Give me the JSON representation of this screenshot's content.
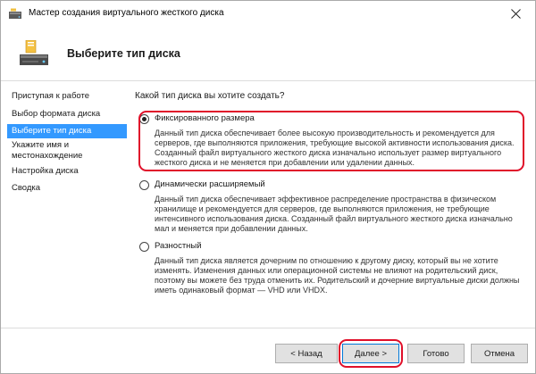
{
  "window": {
    "title": "Мастер создания виртуального жесткого диска"
  },
  "header": {
    "title": "Выберите тип диска"
  },
  "sidebar": {
    "items": [
      {
        "label": "Приступая к работе"
      },
      {
        "label": "Выбор формата диска"
      },
      {
        "label": "Выберите тип диска"
      },
      {
        "label": "Укажите имя и\nместонахождение"
      },
      {
        "label": "Настройка диска"
      },
      {
        "label": "Сводка"
      }
    ],
    "active_index": 2
  },
  "main": {
    "question": "Какой тип диска вы хотите создать?",
    "options": [
      {
        "label": "Фиксированного размера",
        "selected": true,
        "description": "Данный тип диска обеспечивает более высокую производительность и рекомендуется для серверов, где выполняются приложения, требующие высокой активности использования диска. Созданный файл виртуального жесткого диска изначально использует размер виртуального жесткого диска и не меняется при добавлении или удалении данных."
      },
      {
        "label": "Динамически расширяемый",
        "selected": false,
        "description": "Данный тип диска обеспечивает эффективное распределение пространства в физическом хранилище и рекомендуется для серверов, где выполняются приложения, не требующие интенсивного использования диска. Созданный файл виртуального жесткого диска изначально мал и меняется при добавлении данных."
      },
      {
        "label": "Разностный",
        "selected": false,
        "description": "Данный тип диска является дочерним по отношению к другому диску, который вы не хотите изменять. Изменения данных или операционной системы не влияют на родительский диск, поэтому вы можете без труда отменить их. Родительский и дочерние виртуальные диски должны иметь одинаковый формат — VHD или VHDX."
      }
    ]
  },
  "footer": {
    "back_label": "< Назад",
    "next_label": "Далее >",
    "finish_label": "Готово",
    "cancel_label": "Отмена"
  },
  "colors": {
    "active_item": "#3399ff",
    "highlight": "#e0102a",
    "default_button_border": "#0078d7"
  },
  "icons": {
    "title": "disk-wizard-icon",
    "header": "disk-wizard-icon",
    "close": "close-icon"
  }
}
